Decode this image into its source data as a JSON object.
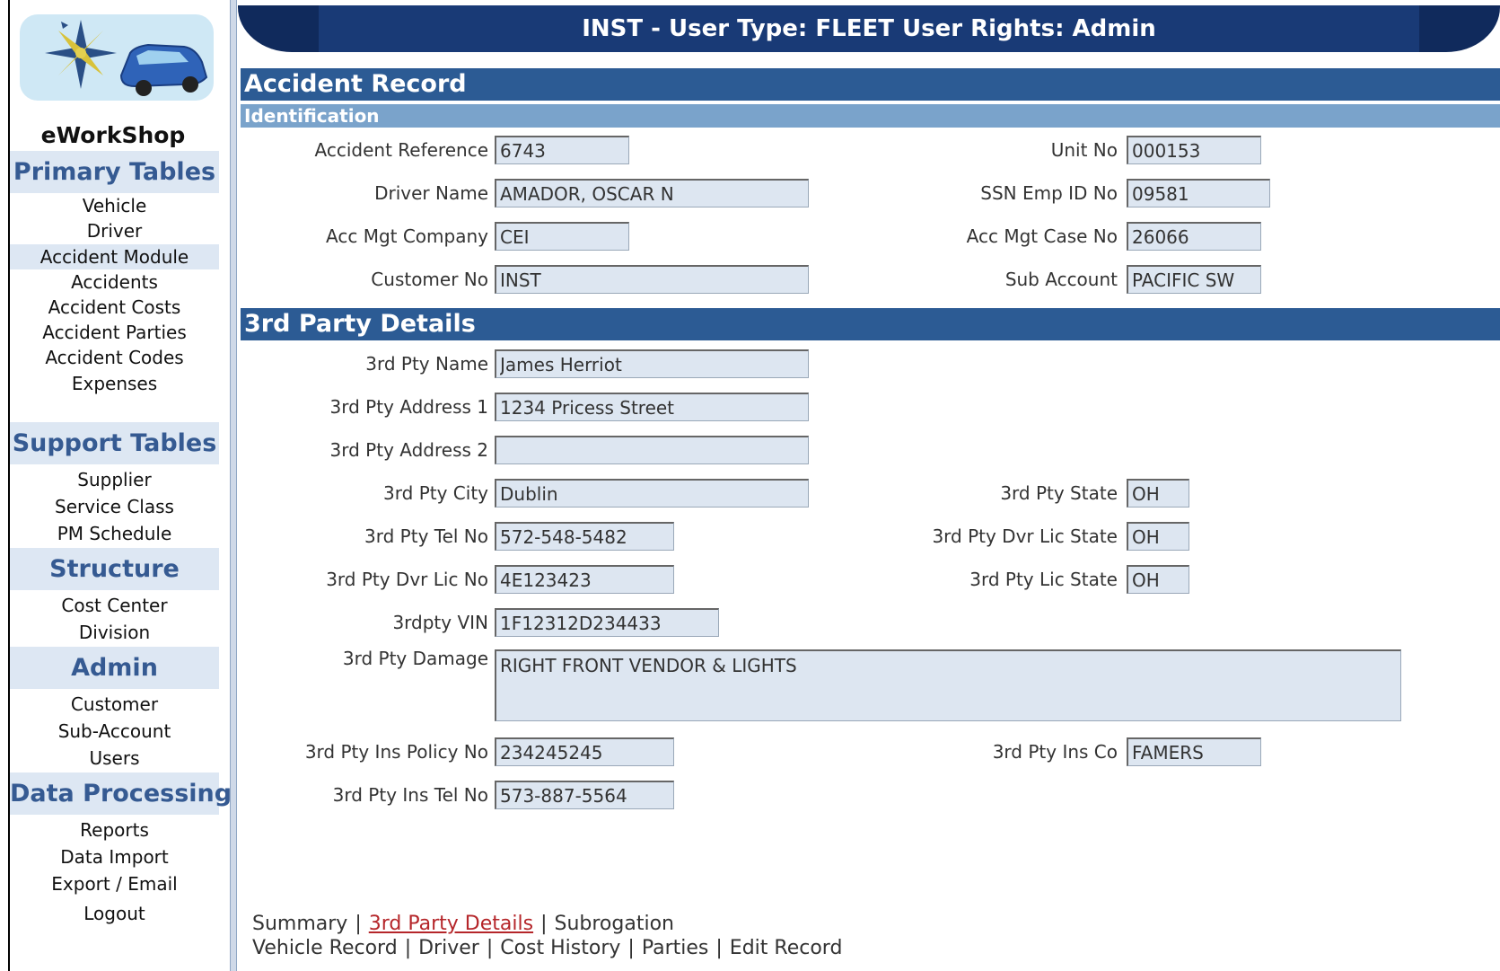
{
  "app": {
    "name": "eWorkShop"
  },
  "header": {
    "title": "INST - User Type: FLEET User Rights: Admin"
  },
  "sidebar": {
    "sections": [
      {
        "title": "Primary Tables",
        "items": [
          "Vehicle",
          "Driver",
          "Accident Module",
          "Accidents",
          "Accident Costs",
          "Accident Parties",
          "Accident Codes",
          "Expenses"
        ]
      },
      {
        "title": "Support Tables",
        "items": [
          "Supplier",
          "Service Class",
          "PM Schedule"
        ]
      },
      {
        "title": "Structure",
        "items": [
          "Cost Center",
          "Division"
        ]
      },
      {
        "title": "Admin",
        "items": [
          "Customer",
          "Sub-Account",
          "Users"
        ]
      },
      {
        "title": "Data Processing",
        "items": [
          "Reports",
          "Data Import",
          "Export / Email",
          "Logout"
        ]
      }
    ]
  },
  "page": {
    "title": "Accident Record",
    "identification": {
      "heading": "Identification",
      "accident_reference": {
        "label": "Accident Reference",
        "value": "6743"
      },
      "unit_no": {
        "label": "Unit No",
        "value": "000153"
      },
      "driver_name": {
        "label": "Driver Name",
        "value": "AMADOR, OSCAR N"
      },
      "ssn_emp_id": {
        "label": "SSN Emp ID No",
        "value": "09581"
      },
      "acc_mgt_company": {
        "label": "Acc Mgt Company",
        "value": "CEI"
      },
      "acc_mgt_case_no": {
        "label": "Acc Mgt Case No",
        "value": "26066"
      },
      "customer_no": {
        "label": "Customer No",
        "value": "INST"
      },
      "sub_account": {
        "label": "Sub Account",
        "value": "PACIFIC SW"
      }
    },
    "third_party": {
      "heading": "3rd Party Details",
      "name": {
        "label": "3rd Pty Name",
        "value": "James Herriot"
      },
      "address1": {
        "label": "3rd Pty Address 1",
        "value": "1234 Pricess Street"
      },
      "address2": {
        "label": "3rd Pty Address 2",
        "value": ""
      },
      "city": {
        "label": "3rd Pty City",
        "value": "Dublin"
      },
      "state": {
        "label": "3rd Pty State",
        "value": "OH"
      },
      "tel_no": {
        "label": "3rd Pty Tel No",
        "value": "572-548-5482"
      },
      "dvr_lic_state": {
        "label": "3rd Pty Dvr Lic State",
        "value": "OH"
      },
      "dvr_lic_no": {
        "label": "3rd Pty Dvr Lic No",
        "value": "4E123423"
      },
      "lic_state": {
        "label": "3rd Pty Lic State",
        "value": "OH"
      },
      "vin": {
        "label": "3rdpty VIN",
        "value": "1F12312D234433"
      },
      "damage": {
        "label": "3rd Pty Damage",
        "value": "RIGHT FRONT VENDOR & LIGHTS"
      },
      "ins_policy_no": {
        "label": "3rd Pty Ins Policy No",
        "value": "234245245"
      },
      "ins_co": {
        "label": "3rd Pty Ins Co",
        "value": "FAMERS"
      },
      "ins_tel_no": {
        "label": "3rd Pty Ins Tel No",
        "value": "573-887-5564"
      }
    },
    "footer_links": {
      "row1": [
        "Summary",
        "3rd Party Details",
        "Subrogation"
      ],
      "row2": [
        "Vehicle Record",
        "Driver",
        "Cost History",
        "Parties",
        "Edit Record"
      ],
      "active": "3rd Party Details",
      "separator": "|"
    }
  },
  "colors": {
    "nav_bg": "#dde7f3",
    "band": "#2c5b94",
    "subband": "#7aa3cb",
    "header": "#193a76",
    "active_link": "#b5262a"
  }
}
